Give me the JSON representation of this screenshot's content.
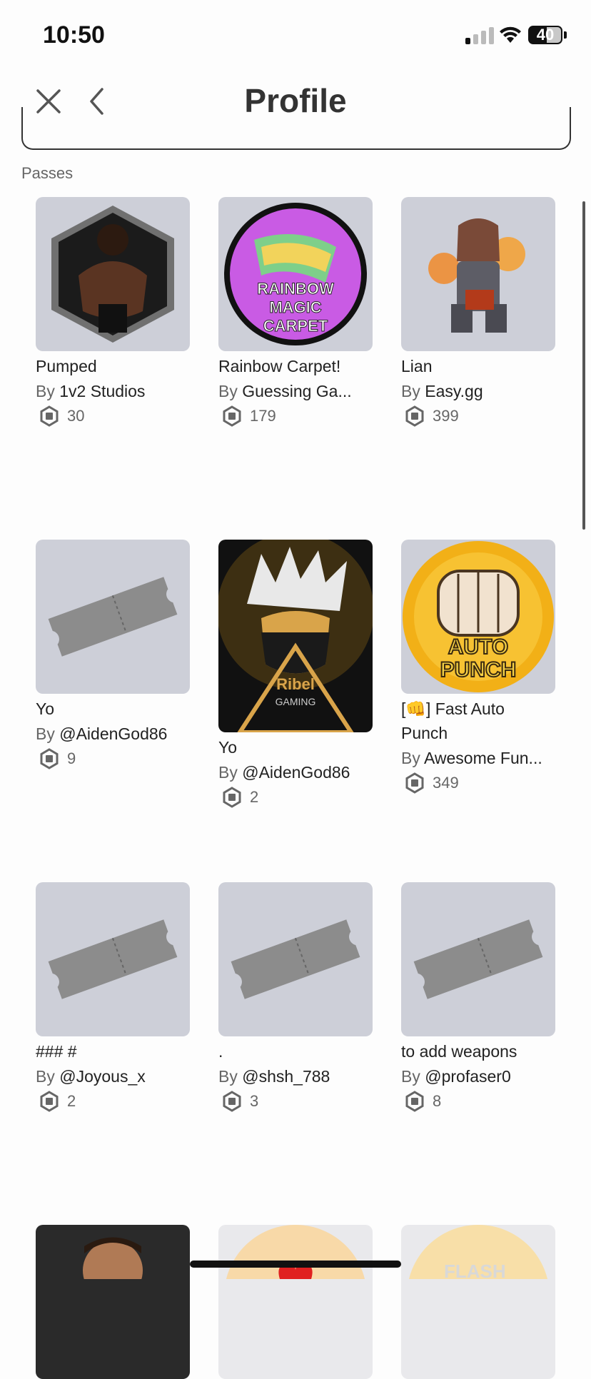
{
  "status": {
    "time": "10:50",
    "battery": "40"
  },
  "header": {
    "title": "Profile"
  },
  "section": {
    "label": "Passes"
  },
  "passes": [
    {
      "name": "Pumped",
      "by": "By",
      "creator": "1v2 Studios",
      "price": "30"
    },
    {
      "name": "Rainbow Carpet!",
      "by": "By",
      "creator": "Guessing Ga...",
      "price": "179"
    },
    {
      "name": "Lian",
      "by": "By",
      "creator": "Easy.gg",
      "price": "399"
    },
    {
      "name": "Yo",
      "by": "By",
      "creator": "@AidenGod86",
      "price": "9"
    },
    {
      "name": "Yo",
      "by": "By",
      "creator": "@AidenGod86",
      "price": "2"
    },
    {
      "name": "[👊] Fast Auto Punch",
      "by": "By",
      "creator": "Awesome Fun...",
      "price": "349"
    },
    {
      "name": "### #",
      "by": "By",
      "creator": "@Joyous_x",
      "price": "2"
    },
    {
      "name": ".",
      "by": "By",
      "creator": "@shsh_788",
      "price": "3"
    },
    {
      "name": "to add weapons",
      "by": "By",
      "creator": "@profaser0",
      "price": "8"
    }
  ],
  "thumb_text": {
    "rainbow": [
      "RAINBOW",
      "MAGIC",
      "CARPET"
    ],
    "ribel": [
      "Ribel",
      "GAMING"
    ],
    "punch": [
      "AUTO",
      "PUNCH"
    ],
    "flash": "FLASH"
  },
  "icons": {
    "close": "close-icon",
    "back": "chevron-left-icon",
    "robux": "robux-icon",
    "ticket": "ticket-icon"
  }
}
